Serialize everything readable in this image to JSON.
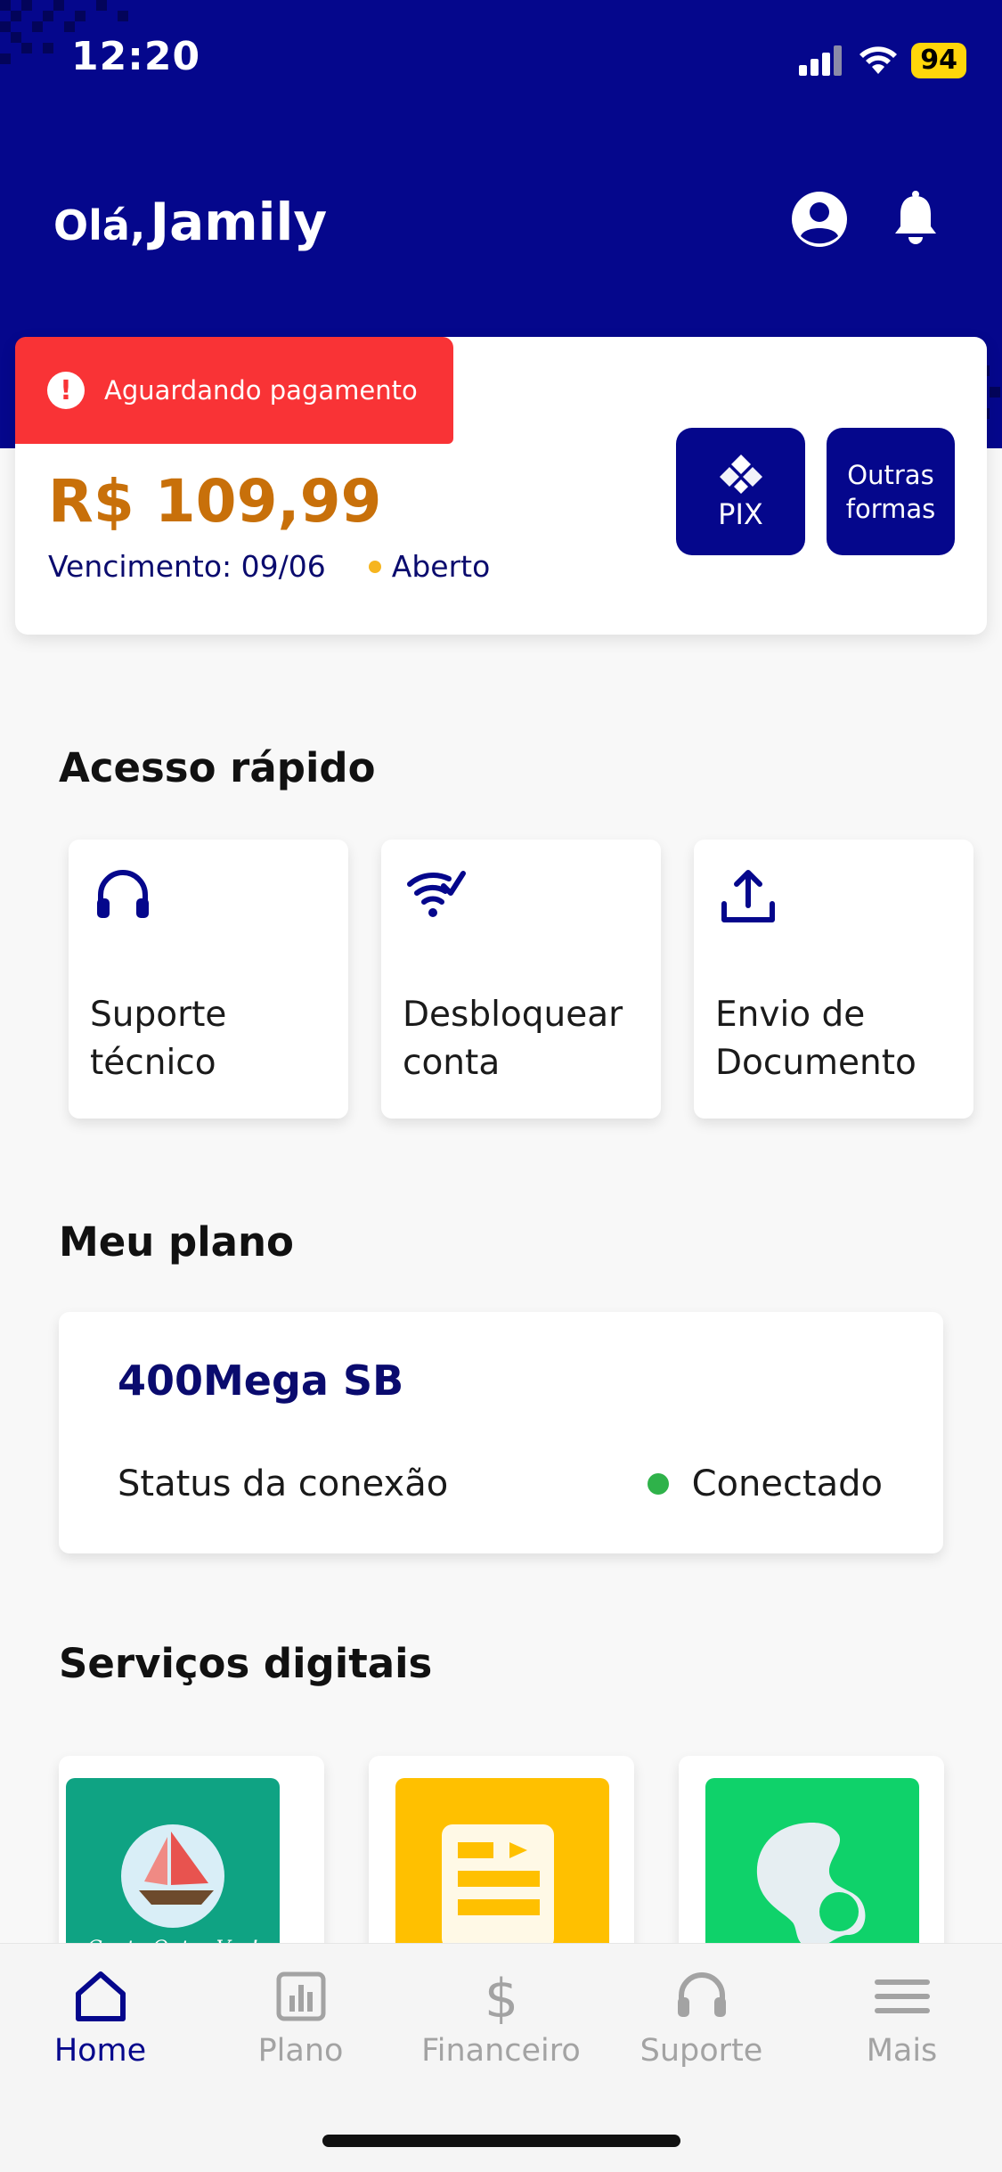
{
  "status_bar": {
    "time": "12:20",
    "battery": "94"
  },
  "header": {
    "greeting": "Olá,",
    "user_name": "Jamily",
    "icons": [
      "profile-icon",
      "bell-icon"
    ]
  },
  "bill": {
    "badge": "Aguardando pagamento",
    "amount": "R$ 109,99",
    "due": "Vencimento: 09/06",
    "status": "Aberto",
    "pix_label": "PIX",
    "other_line1": "Outras",
    "other_line2": "formas"
  },
  "quick_access": {
    "title": "Acesso rápido",
    "items": [
      {
        "line1": "Suporte",
        "line2": "técnico",
        "icon": "headset-icon"
      },
      {
        "line1": "Desbloquear",
        "line2": "conta",
        "icon": "wifi-check-icon"
      },
      {
        "line1": "Envio de",
        "line2": "Documento",
        "icon": "upload-icon"
      }
    ]
  },
  "plan": {
    "title": "Meu plano",
    "name": "400Mega SB",
    "status_label": "Status da conexão",
    "status_value": "Conectado"
  },
  "services": {
    "title": "Serviços digitais",
    "first_tile_text": "Conta Outra Vez!"
  },
  "bottom_nav": {
    "items": [
      {
        "label": "Home",
        "icon": "home-icon",
        "active": true
      },
      {
        "label": "Plano",
        "icon": "chart-icon",
        "active": false
      },
      {
        "label": "Financeiro",
        "icon": "dollar-icon",
        "active": false
      },
      {
        "label": "Suporte",
        "icon": "headset-icon",
        "active": false
      },
      {
        "label": "Mais",
        "icon": "menu-icon",
        "active": false
      }
    ]
  },
  "colors": {
    "brand": "#05078c",
    "alert": "#f93336",
    "amount": "#c8700a",
    "connected": "#2fb24a"
  }
}
